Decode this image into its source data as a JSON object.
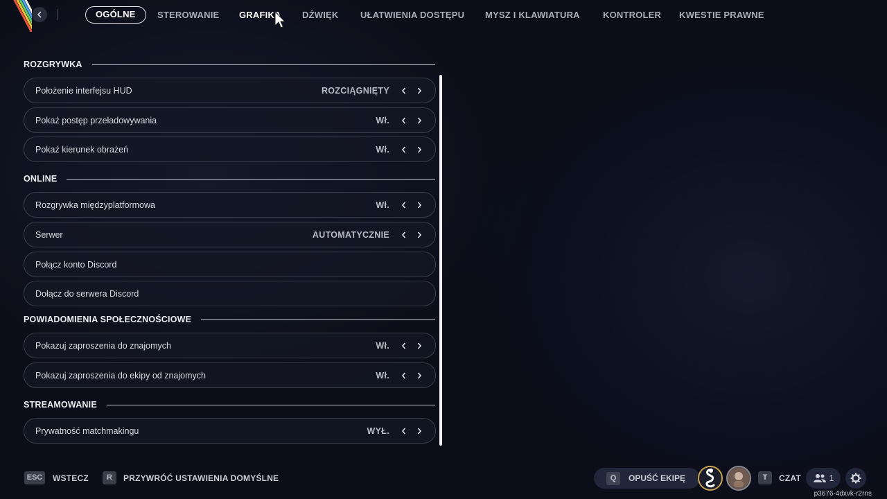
{
  "nav": {
    "tabs": [
      {
        "label": "OGÓLNE"
      },
      {
        "label": "STEROWANIE"
      },
      {
        "label": "GRAFIKA"
      },
      {
        "label": "DŹWIĘK"
      },
      {
        "label": "UŁATWIENIA DOSTĘPU"
      },
      {
        "label": "MYSZ I KLAWIATURA"
      },
      {
        "label": "KONTROLER"
      },
      {
        "label": "KWESTIE PRAWNE"
      }
    ],
    "active_tab": "OGÓLNE"
  },
  "sections": [
    {
      "title": "ROZGRYWKA",
      "rows": [
        {
          "label": "Położenie interfejsu HUD",
          "value": "ROZCIĄGNIĘTY"
        },
        {
          "label": "Pokaż postęp przeładowywania",
          "value": "Wł."
        },
        {
          "label": "Pokaż kierunek obrażeń",
          "value": "Wł."
        }
      ]
    },
    {
      "title": "ONLINE",
      "rows": [
        {
          "label": "Rozgrywka międzyplatformowa",
          "value": "Wł."
        },
        {
          "label": "Serwer",
          "value": "AUTOMATYCZNIE"
        },
        {
          "label": "Połącz konto Discord",
          "value": ""
        },
        {
          "label": "Dołącz do serwera Discord",
          "value": ""
        }
      ]
    },
    {
      "title": "POWIADOMIENIA SPOŁECZNOŚCIOWE",
      "rows": [
        {
          "label": "Pokazuj zaproszenia do znajomych",
          "value": "Wł."
        },
        {
          "label": "Pokazuj zaproszenia do ekipy od znajomych",
          "value": "Wł."
        }
      ]
    },
    {
      "title": "STREAMOWANIE",
      "rows": [
        {
          "label": "Prywatność matchmakingu",
          "value": "WYŁ."
        }
      ]
    }
  ],
  "footer": {
    "back_key": "ESC",
    "back_label": "WSTECZ",
    "reset_key": "R",
    "reset_label": "PRZYWRÓĆ USTAWIENIA DOMYŚLNE",
    "leave_key": "Q",
    "leave_label": "OPUŚĆ EKIPĘ",
    "chat_key": "T",
    "chat_label": "CZAT",
    "friends_count": "1",
    "session_id": "p3676-4dxvk-r2rns"
  },
  "colors": {
    "background": "#0a0c17",
    "accent_white": "#e8e8ee",
    "row_border": "#3b3f4d",
    "avatar_ring": "#c9a04b"
  }
}
